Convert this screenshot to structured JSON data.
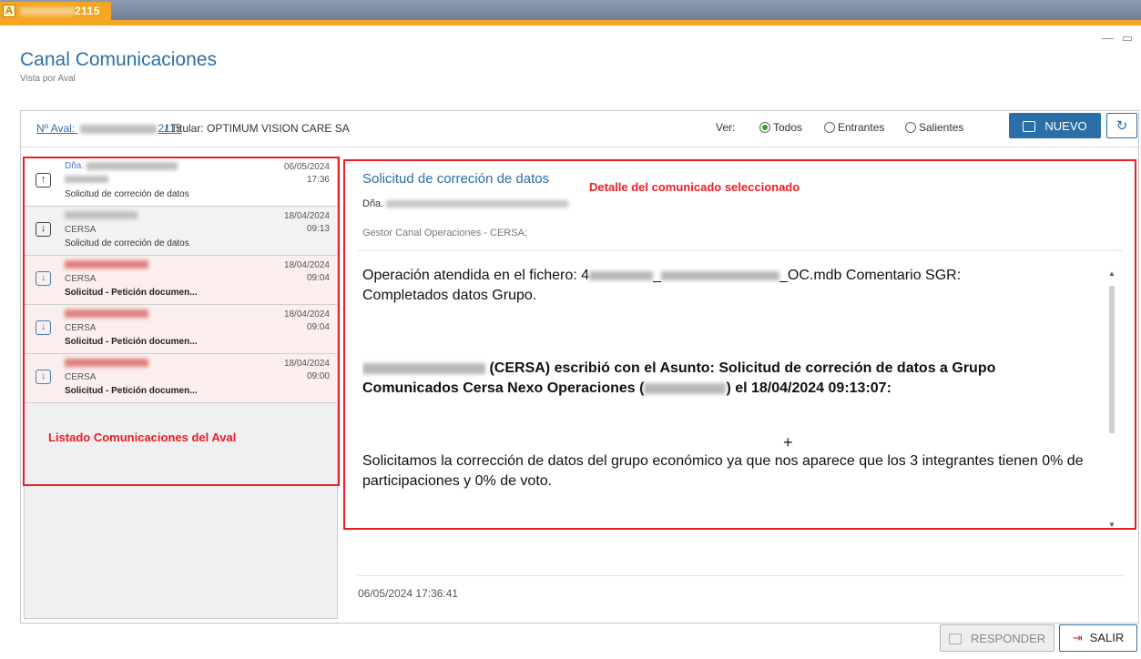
{
  "window": {
    "tab_title_suffix": "2115",
    "app_icon_letter": "A",
    "minimize": "—",
    "maximize": "▭"
  },
  "page": {
    "title": "Canal Comunicaciones",
    "subtitle": "Vista por Aval"
  },
  "header": {
    "aval_prefix": "Nº Aval: ",
    "aval_suffix": "2115",
    "titular_label": "/ Titular:  OPTIMUM VISION CARE SA",
    "ver_label": "Ver:",
    "filters": [
      {
        "label": "Todos",
        "selected": true
      },
      {
        "label": "Entrantes",
        "selected": false
      },
      {
        "label": "Salientes",
        "selected": false
      }
    ],
    "nuevo_label": "NUEVO",
    "refresh_icon": "↻"
  },
  "list": {
    "items": [
      {
        "name_prefix": "Dña.",
        "org": "",
        "subject": "Solicitud de correción de datos",
        "date": "06/05/2024",
        "time": "17:36",
        "direction": "out",
        "icon": "↑"
      },
      {
        "name_prefix": "",
        "org": "CERSA",
        "subject": "Solicitud de correción de datos",
        "date": "18/04/2024",
        "time": "09:13",
        "direction": "in",
        "icon": "↓"
      },
      {
        "name_prefix": "",
        "org": "CERSA",
        "subject": "Solicitud - Petición documen...",
        "date": "18/04/2024",
        "time": "09:04",
        "direction": "in",
        "icon": "↓"
      },
      {
        "name_prefix": "",
        "org": "CERSA",
        "subject": "Solicitud - Petición documen...",
        "date": "18/04/2024",
        "time": "09:04",
        "direction": "in",
        "icon": "↓"
      },
      {
        "name_prefix": "",
        "org": "CERSA",
        "subject": "Solicitud - Petición documen...",
        "date": "18/04/2024",
        "time": "09:00",
        "direction": "in",
        "icon": "↓"
      }
    ]
  },
  "detail": {
    "subject": "Solicitud de correción de datos",
    "from_prefix": "Dña.",
    "to": "Gestor Canal Operaciones - CERSA;",
    "body": {
      "p1_a": "Operación atendida en el fichero: 4",
      "p1_b": "_OC.mdb Comentario SGR:",
      "p1_c": "Completados datos Grupo.",
      "p2_a": "(CERSA) escribió con el Asunto: Solicitud de correción de datos a Grupo",
      "p2_b": "Comunicados Cersa Nexo Operaciones (",
      "p2_c": ") el 18/04/2024 09:13:07:",
      "p3": "Solicitamos la corrección de datos del grupo económico ya que nos aparece que los 3 integrantes tienen 0% de participaciones y 0% de voto."
    },
    "footer_date": "06/05/2024 17:36:41"
  },
  "annotations": {
    "detail_label": "Detalle del comunicado seleccionado",
    "list_label": "Listado Comunicaciones del Aval"
  },
  "buttons": {
    "responder": "RESPONDER",
    "salir": "SALIR",
    "salir_icon": "⇥"
  }
}
